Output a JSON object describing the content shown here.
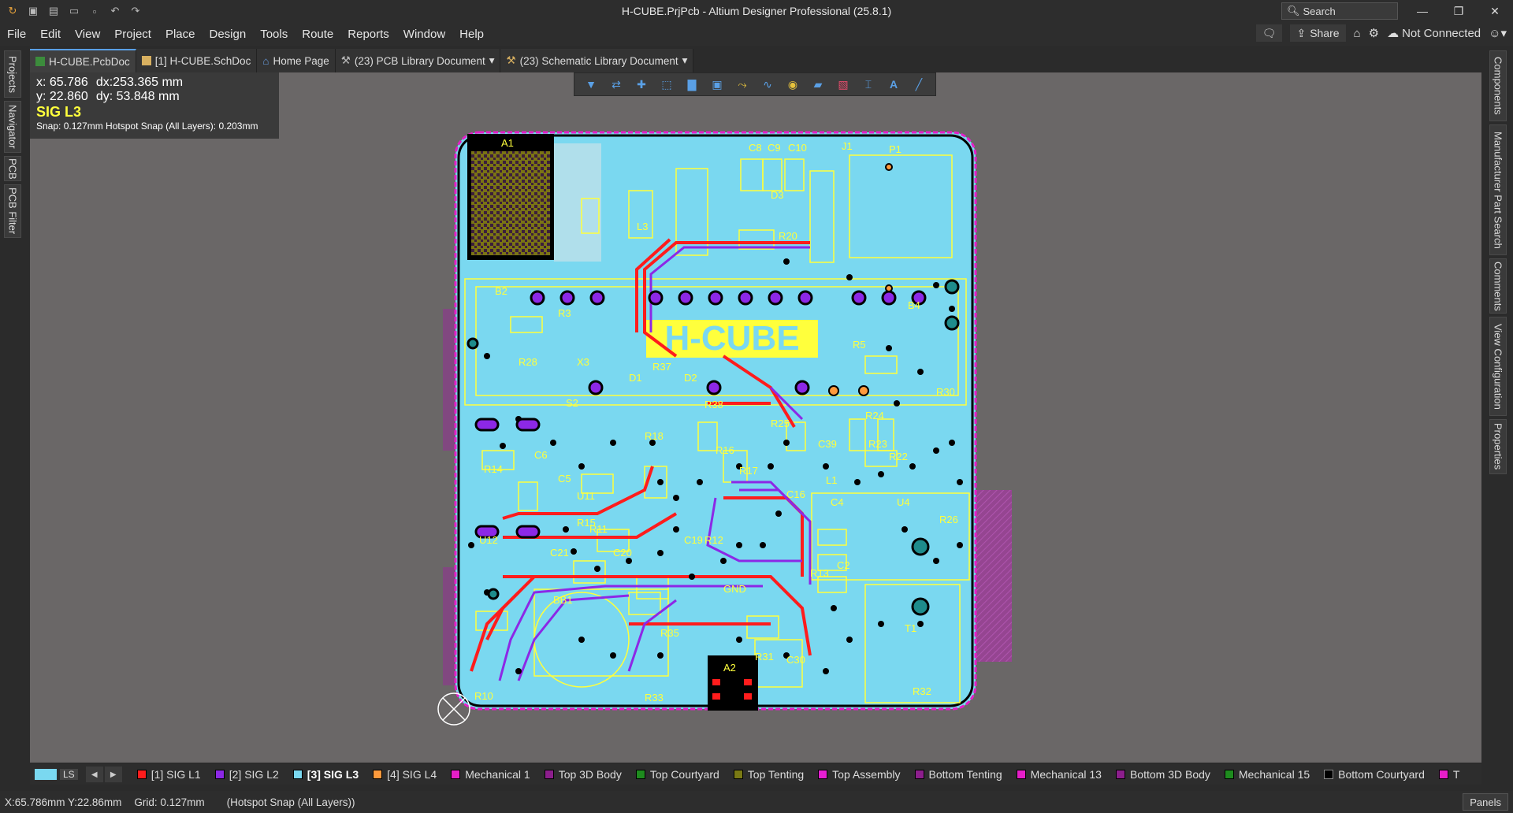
{
  "window": {
    "title": "H-CUBE.PrjPcb - Altium Designer Professional (25.8.1)",
    "search_placeholder": "Search",
    "buttons": [
      "minimize",
      "restore",
      "close"
    ]
  },
  "menu": {
    "items": [
      "File",
      "Edit",
      "View",
      "Project",
      "Place",
      "Design",
      "Tools",
      "Route",
      "Reports",
      "Window",
      "Help"
    ],
    "share": "Share",
    "connection": "Not Connected"
  },
  "tabs": [
    {
      "label": "H-CUBE.PcbDoc",
      "active": true
    },
    {
      "label": "[1] H-CUBE.SchDoc",
      "active": false
    },
    {
      "label": "Home Page",
      "active": false
    },
    {
      "label": "(23) PCB Library Document",
      "active": false
    },
    {
      "label": "(23) Schematic Library Document",
      "active": false
    }
  ],
  "left_panels": [
    "Projects",
    "Navigator",
    "PCB",
    "PCB Filter"
  ],
  "right_panels": [
    "Components",
    "Manufacturer Part Search",
    "Comments",
    "View Configuration",
    "Properties"
  ],
  "hud": {
    "x": "x: 65.786",
    "dx": "dx:253.365 mm",
    "y": "y: 22.860",
    "dy": "dy: 53.848  mm",
    "layer": "SIG L3",
    "snap": "Snap: 0.127mm Hotspot Snap (All Layers): 0.203mm"
  },
  "board": {
    "title_label": "H-CUBE",
    "designators": [
      "A1",
      "A2",
      "P1",
      "J1",
      "C8",
      "C9",
      "C10",
      "D3",
      "R20",
      "R39",
      "R3",
      "R5",
      "B2",
      "B4",
      "X3",
      "R28",
      "R37",
      "D1",
      "D2",
      "S2",
      "R38",
      "R18",
      "R16",
      "R17",
      "R14",
      "C6",
      "C5",
      "U11",
      "R15",
      "U12",
      "R11",
      "R12",
      "C21",
      "C20",
      "C19",
      "BB1",
      "R13",
      "R24",
      "R23",
      "R22",
      "R25",
      "C39",
      "C4",
      "C2",
      "U4",
      "R26",
      "R31",
      "R32",
      "C30",
      "R10",
      "R35",
      "R33",
      "R30",
      "C16",
      "L1",
      "L3",
      "T1",
      "GND"
    ]
  },
  "layers": [
    {
      "name": "[1] SIG L1",
      "color": "#ff1c1c"
    },
    {
      "name": "[2] SIG L2",
      "color": "#8c28e6"
    },
    {
      "name": "[3] SIG L3",
      "color": "#7ad8f0",
      "active": true
    },
    {
      "name": "[4] SIG L4",
      "color": "#ff9a3c"
    },
    {
      "name": "Mechanical 1",
      "color": "#e61ec8"
    },
    {
      "name": "Top 3D Body",
      "color": "#8c1e8c"
    },
    {
      "name": "Top Courtyard",
      "color": "#1e8c1e"
    },
    {
      "name": "Top Tenting",
      "color": "#7a7a14"
    },
    {
      "name": "Top Assembly",
      "color": "#e61ed2"
    },
    {
      "name": "Bottom Tenting",
      "color": "#8c1e8c"
    },
    {
      "name": "Mechanical 13",
      "color": "#e61ec8"
    },
    {
      "name": "Bottom 3D Body",
      "color": "#8c1e8c"
    },
    {
      "name": "Mechanical 15",
      "color": "#1e8c1e"
    },
    {
      "name": "Bottom Courtyard",
      "color": "#000000"
    },
    {
      "name": "T",
      "color": "#e61ec8"
    }
  ],
  "layer_set": "LS",
  "status": {
    "coords": "X:65.786mm Y:22.86mm",
    "grid": "Grid: 0.127mm",
    "snap": "(Hotspot Snap (All Layers))",
    "panels": "Panels"
  }
}
